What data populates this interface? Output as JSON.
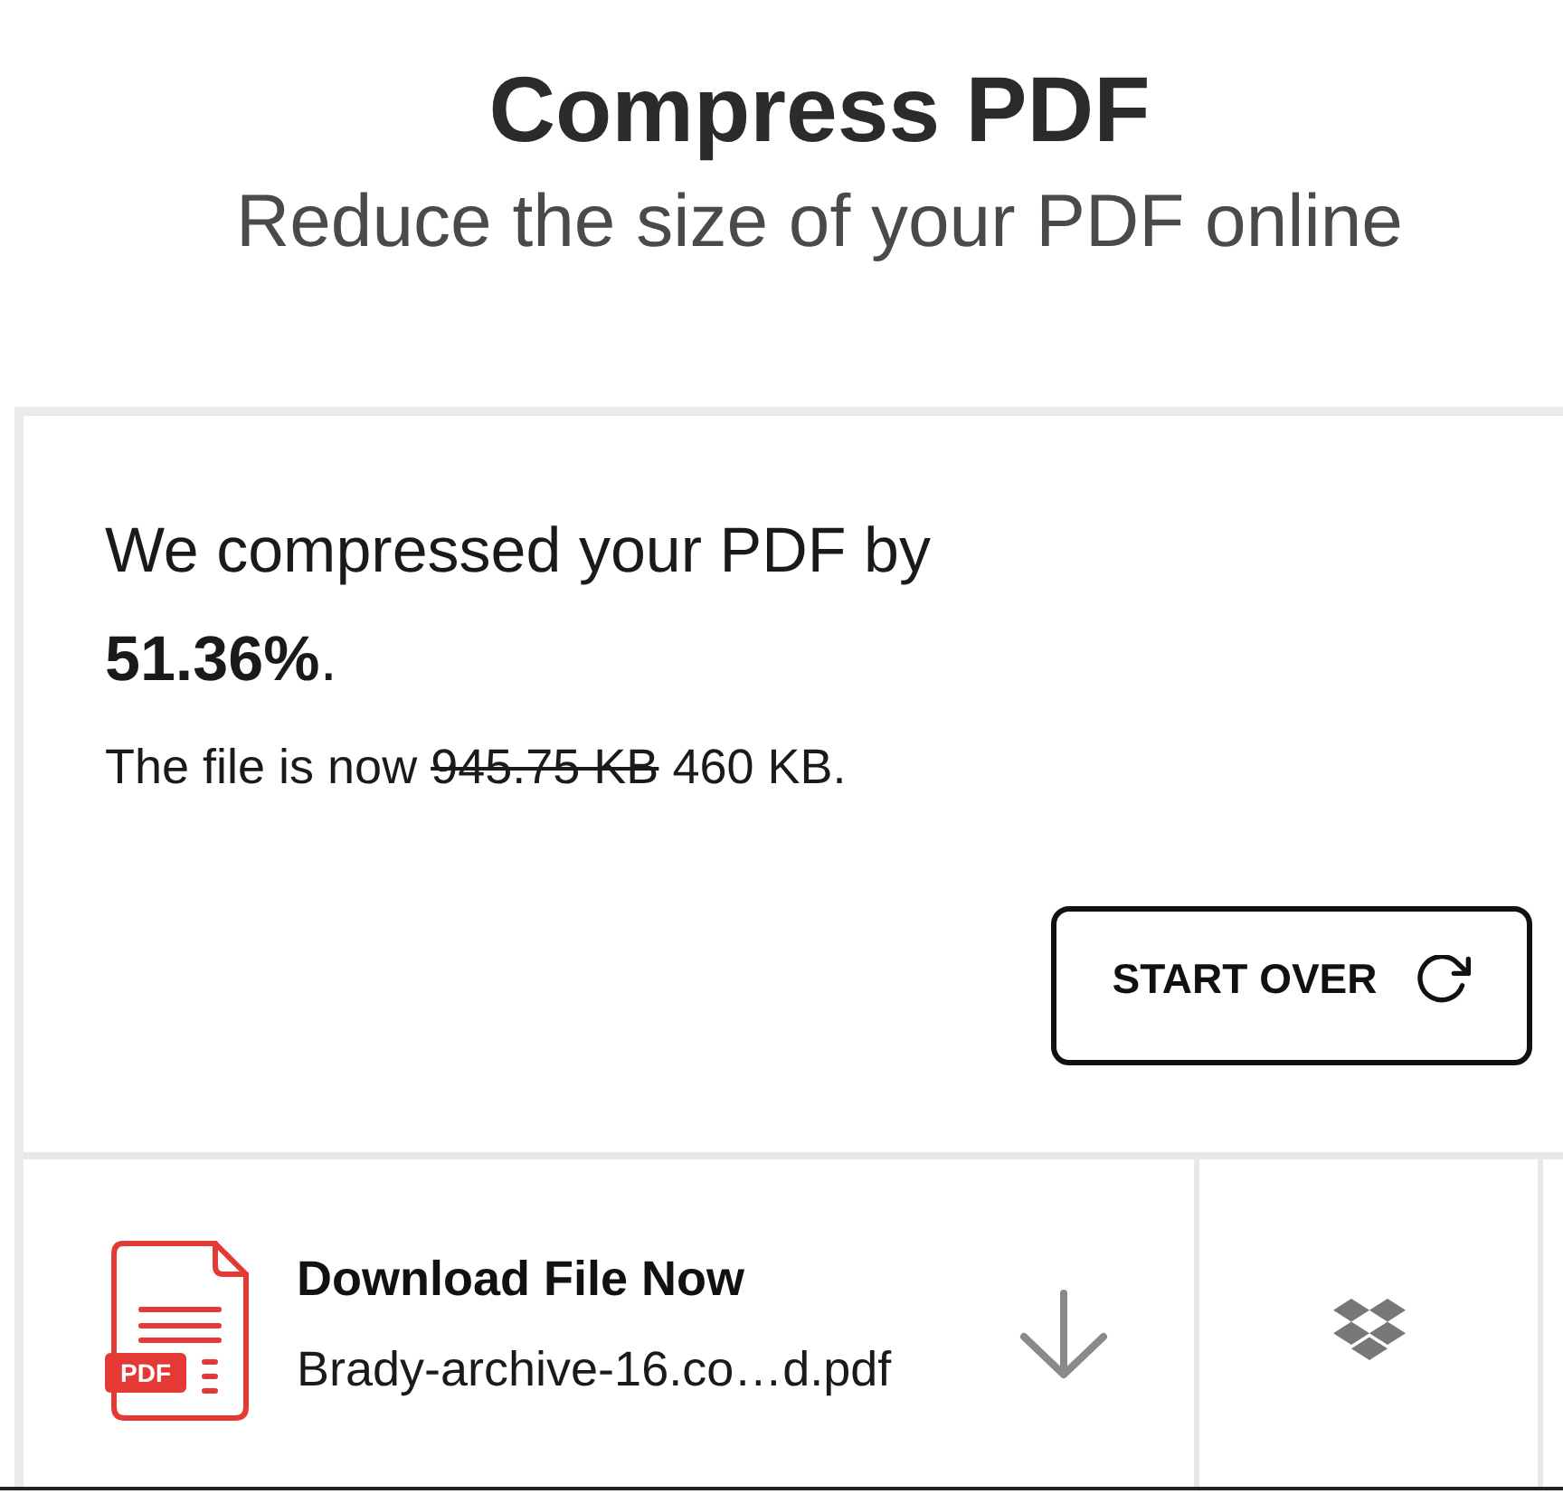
{
  "header": {
    "title": "Compress PDF",
    "subtitle": "Reduce the size of your PDF online"
  },
  "result": {
    "summary": "We compressed your PDF by **51.36%**.",
    "size_prefix": "The file is now",
    "old_size": "945.75 KB",
    "new_size": "460 KB."
  },
  "start_over": {
    "label": "START OVER"
  },
  "download": {
    "file_badge": "PDF",
    "title": "Download File Now",
    "filename": "Brady-archive-16.co…d.pdf"
  }
}
